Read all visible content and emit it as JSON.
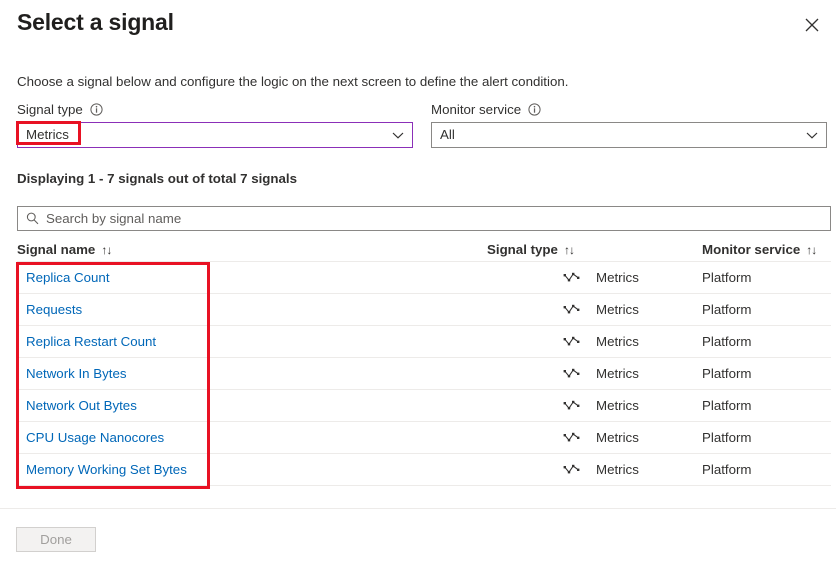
{
  "dialog": {
    "title": "Select a signal",
    "close_label": "Close",
    "close_icon": "close-icon",
    "description": "Choose a signal below and configure the logic on the next screen to define the alert condition."
  },
  "filters": {
    "signal_type": {
      "label": "Signal type",
      "info_icon": "info-icon",
      "value": "Metrics",
      "chevron_icon": "chevron-down-icon",
      "focused": true
    },
    "monitor_service": {
      "label": "Monitor service",
      "info_icon": "info-icon",
      "value": "All",
      "chevron_icon": "chevron-down-icon",
      "focused": false
    }
  },
  "results": {
    "count_text": "Displaying 1 - 7 signals out of total 7 signals",
    "search": {
      "placeholder": "Search by signal name",
      "value": "",
      "icon": "search-icon"
    }
  },
  "table": {
    "columns": [
      {
        "key": "signal_name",
        "label": "Signal name",
        "sort_icon": "sort-icon"
      },
      {
        "key": "signal_type",
        "label": "Signal type",
        "sort_icon": "sort-icon"
      },
      {
        "key": "monitor_service",
        "label": "Monitor service",
        "sort_icon": "sort-icon"
      }
    ],
    "rows": [
      {
        "signal_name": "Replica Count",
        "type_icon": "line-chart-icon",
        "signal_type": "Metrics",
        "monitor_service": "Platform"
      },
      {
        "signal_name": "Requests",
        "type_icon": "line-chart-icon",
        "signal_type": "Metrics",
        "monitor_service": "Platform"
      },
      {
        "signal_name": "Replica Restart Count",
        "type_icon": "line-chart-icon",
        "signal_type": "Metrics",
        "monitor_service": "Platform"
      },
      {
        "signal_name": "Network In Bytes",
        "type_icon": "line-chart-icon",
        "signal_type": "Metrics",
        "monitor_service": "Platform"
      },
      {
        "signal_name": "Network Out Bytes",
        "type_icon": "line-chart-icon",
        "signal_type": "Metrics",
        "monitor_service": "Platform"
      },
      {
        "signal_name": "CPU Usage Nanocores",
        "type_icon": "line-chart-icon",
        "signal_type": "Metrics",
        "monitor_service": "Platform"
      },
      {
        "signal_name": "Memory Working Set Bytes",
        "type_icon": "line-chart-icon",
        "signal_type": "Metrics",
        "monitor_service": "Platform"
      }
    ]
  },
  "footer": {
    "done_label": "Done",
    "done_disabled": true
  },
  "annotations": [
    {
      "name": "metrics-highlight",
      "color": "#e81123"
    },
    {
      "name": "signal-names-highlight",
      "color": "#e81123"
    }
  ],
  "sort_glyph": "↑↓"
}
